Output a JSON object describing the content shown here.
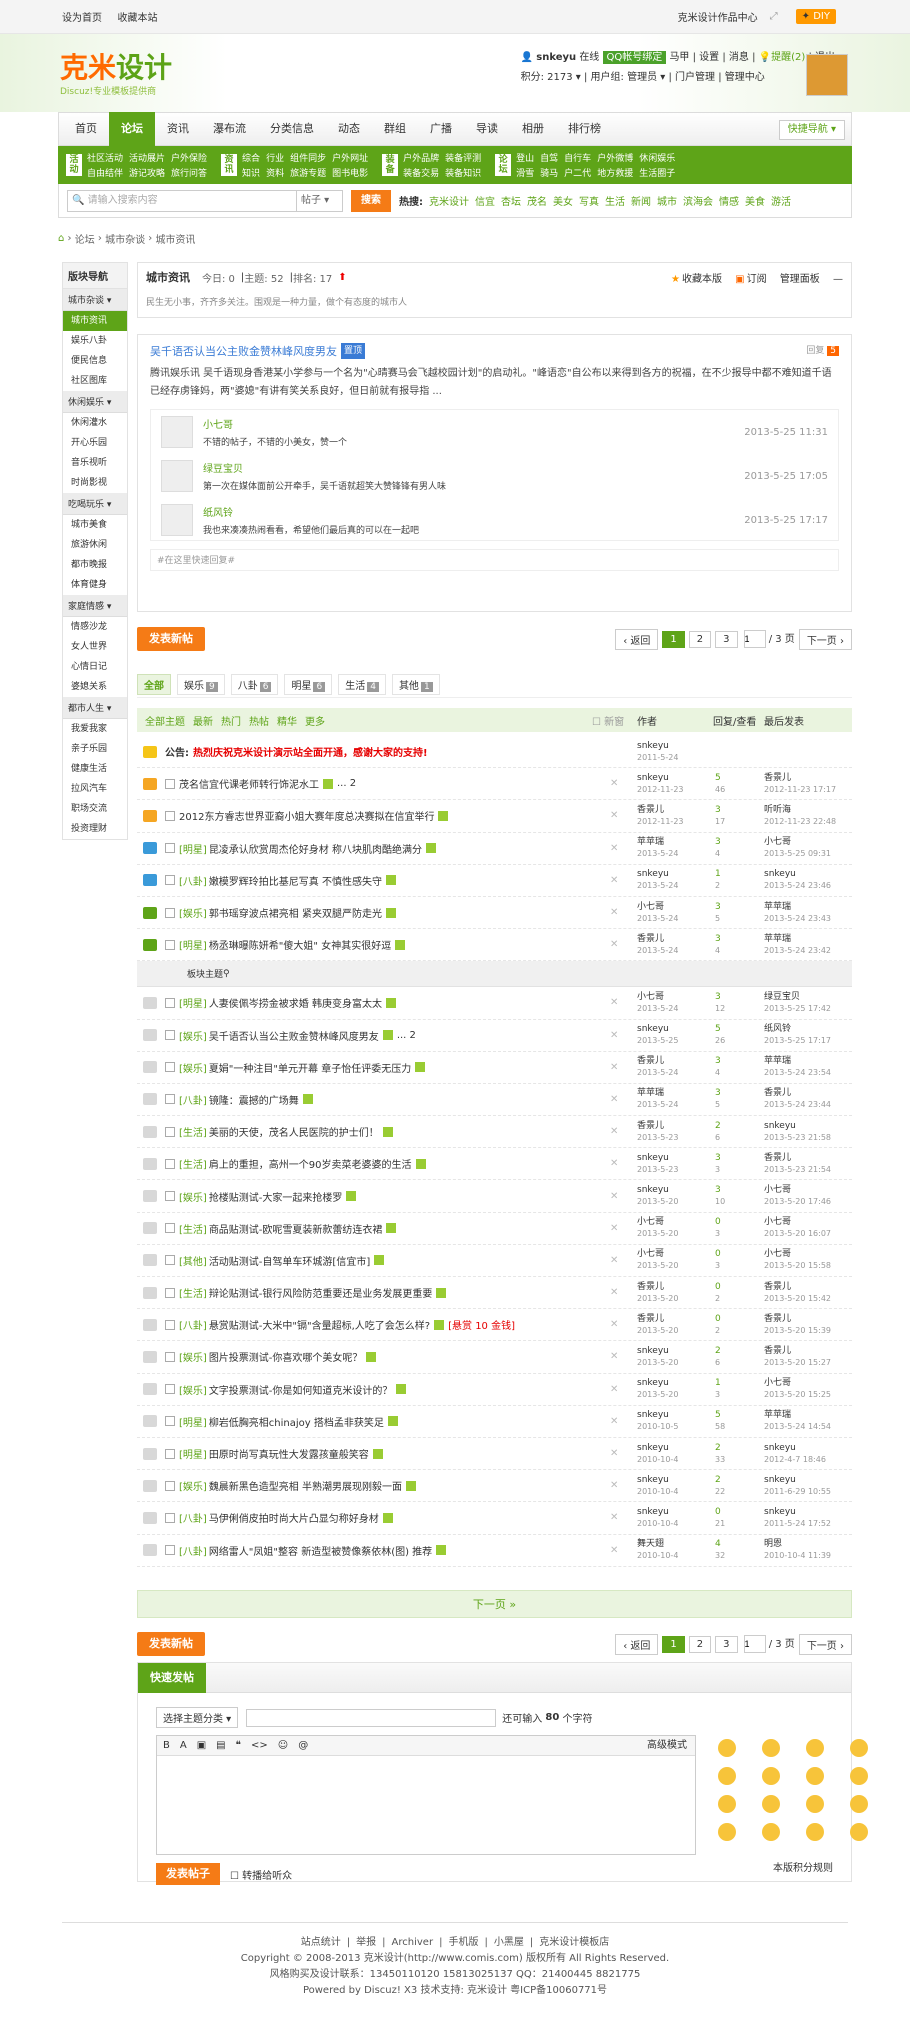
{
  "topbar": {
    "left": [
      "设为首页",
      "收藏本站"
    ],
    "right": "克米设计作品中心",
    "diy": "DIY"
  },
  "logo": {
    "text1": "克米",
    "text2": "设计",
    "sub": "Discuz!专业模板提供商"
  },
  "user": {
    "name": "snkeyu",
    "online": "在线",
    "qq": "QQ帐号绑定",
    "items": [
      "马甲",
      "设置",
      "消息",
      "提醒(2)",
      "退出"
    ],
    "points": "积分: 2173",
    "group": "用户组: 管理员",
    "links": [
      "门户管理",
      "管理中心"
    ]
  },
  "nav": {
    "items": [
      "首页",
      "论坛",
      "资讯",
      "瀑布流",
      "分类信息",
      "动态",
      "群组",
      "广播",
      "导读",
      "相册",
      "排行榜"
    ],
    "active": 1,
    "quick": "快捷导航"
  },
  "subnav": [
    {
      "tag": "活动",
      "items": [
        "社区活动",
        "活动展片",
        "户外保险",
        "自由结伴",
        "游记攻略",
        "旅行问答"
      ]
    },
    {
      "tag": "资讯",
      "items": [
        "综合",
        "行业",
        "组件同步",
        "户外网址",
        "知识",
        "资料",
        "旅游专题",
        "图书电影"
      ]
    },
    {
      "tag": "装备",
      "items": [
        "户外品牌",
        "装备评测",
        "装备交易",
        "装备知识"
      ]
    },
    {
      "tag": "论坛",
      "items": [
        "登山",
        "自驾",
        "自行车",
        "户外微博",
        "休闲娱乐",
        "滑雪",
        "骑马",
        "户二代",
        "地方救援",
        "生活圈子"
      ]
    }
  ],
  "search": {
    "placeholder": "请输入搜索内容",
    "type": "帖子",
    "button": "搜索",
    "hot_label": "热搜:",
    "hot": [
      "克米设计",
      "信宜",
      "杏坛",
      "茂名",
      "美女",
      "写真",
      "生活",
      "新闻",
      "城市",
      "滨海会",
      "情感",
      "美食",
      "游活"
    ]
  },
  "crumb": [
    "论坛",
    "城市杂谈",
    "城市资讯"
  ],
  "sidebar": {
    "title": "版块导航",
    "groups": [
      {
        "name": "城市杂谈",
        "items": [
          "城市资讯",
          "娱乐八卦",
          "便民信息",
          "社区图库"
        ]
      },
      {
        "name": "休闲娱乐",
        "items": [
          "休闲灌水",
          "开心乐园",
          "音乐视听",
          "时尚影视"
        ]
      },
      {
        "name": "吃喝玩乐",
        "items": [
          "城市美食",
          "旅游休闲",
          "都市晚报",
          "体育健身"
        ]
      },
      {
        "name": "家庭情感",
        "items": [
          "情感沙龙",
          "女人世界",
          "心情日记",
          "婆媳关系"
        ]
      },
      {
        "name": "都市人生",
        "items": [
          "我爱我家",
          "亲子乐园",
          "健康生活",
          "拉风汽车",
          "职场交流",
          "投资理财"
        ]
      }
    ]
  },
  "forum": {
    "name": "城市资讯",
    "today": "今日: 0",
    "topics": "主题: 52",
    "rank": "排名: 17",
    "fav": "收藏本版",
    "rss": "订阅",
    "admin": "管理面板",
    "desc": "民生无小事，齐齐多关注。围观是一种力量，做个有态度的城市人"
  },
  "topic": {
    "title": "吴千语否认当公主败金赞林峰风度男友",
    "badge": "置顶",
    "reply_label": "回复",
    "reply": "5",
    "body": "腾讯娱乐讯 吴千语现身香港某小学参与一个名为\"心晴赛马会飞越校园计划\"的启动礼。\"峰语恋\"自公布以来得到各方的祝福，在不少报导中都不难知道千语已经存虏锋妈，两\"婆媳\"有讲有笑关系良好，但日前就有报导指 ...",
    "comments": [
      {
        "name": "小七哥",
        "text": "不错的帖子，不错的小美女，赞一个",
        "date": "2013-5-25 11:31"
      },
      {
        "name": "绿豆宝贝",
        "text": "第一次在媒体面前公开牵手，吴千语就超笑大赞锋锋有男人味",
        "date": "2013-5-25 17:05"
      },
      {
        "name": "纸风铃",
        "text": "我也来凑凑热闹看看，希望他们最后真的可以在一起吧",
        "date": "2013-5-25 17:17"
      }
    ],
    "quick_reply": "#在这里快速回复#"
  },
  "post_btn": "发表新帖",
  "pager": {
    "prev": "返回",
    "pages": [
      "1",
      "2",
      "3"
    ],
    "current": "1",
    "total": "/ 3 页",
    "next": "下一页"
  },
  "filters": [
    {
      "label": "全部",
      "n": ""
    },
    {
      "label": "娱乐",
      "n": "9"
    },
    {
      "label": "八卦",
      "n": "6"
    },
    {
      "label": "明星",
      "n": "6"
    },
    {
      "label": "生活",
      "n": "4"
    },
    {
      "label": "其他",
      "n": "1"
    }
  ],
  "thead": {
    "items": [
      "全部主题",
      "最新",
      "热门",
      "热帖",
      "精华",
      "更多"
    ],
    "newwin": "新窗",
    "author": "作者",
    "replies": "回复/查看",
    "last": "最后发表"
  },
  "announce": {
    "label": "公告:",
    "text": "热烈庆祝克米设计演示站全面开通，感谢大家的支持!",
    "author": "snkeyu",
    "date": "2011-5-24"
  },
  "sticky": [
    {
      "cat": "",
      "title": "茂名信宜代课老师转行饰泥水工",
      "tail": "... 2",
      "au": "snkeyu",
      "ad": "2012-11-23",
      "r": "5",
      "v": "46",
      "lu": "香景儿",
      "ld": "2012-11-23 17:17",
      "ic": "#f5a623"
    },
    {
      "cat": "",
      "title": "2012东方睿志世界亚裔小姐大赛年度总决赛拟在信宜举行",
      "tail": "",
      "au": "香景儿",
      "ad": "2012-11-23",
      "r": "3",
      "v": "17",
      "lu": "听听海",
      "ld": "2012-11-23 22:48",
      "ic": "#f5a623"
    },
    {
      "cat": "[明星]",
      "title": "昆凌承认欣赏周杰伦好身材 称八块肌肉酷绝满分",
      "tail": "",
      "au": "苹苹瑞",
      "ad": "2013-5-24",
      "r": "3",
      "v": "4",
      "lu": "小七哥",
      "ld": "2013-5-25 09:31",
      "ic": "#3a9ad9"
    },
    {
      "cat": "[八卦]",
      "title": "嫩模罗辉玲拍比基尼写真 不慎性感失守",
      "tail": "",
      "au": "snkeyu",
      "ad": "2013-5-24",
      "r": "1",
      "v": "2",
      "lu": "snkeyu",
      "ld": "2013-5-24 23:46",
      "ic": "#3a9ad9"
    },
    {
      "cat": "[娱乐]",
      "title": "郭书瑶穿波点裙亮相 紧夹双腿严防走光",
      "tail": "",
      "au": "小七哥",
      "ad": "2013-5-24",
      "r": "3",
      "v": "5",
      "lu": "苹苹瑞",
      "ld": "2013-5-24 23:43",
      "ic": "#5ea418"
    },
    {
      "cat": "[明星]",
      "title": "杨丞琳曝陈妍希\"傻大姐\" 女神其实很好逗",
      "tail": "",
      "au": "香景儿",
      "ad": "2013-5-24",
      "r": "3",
      "v": "4",
      "lu": "苹苹瑞",
      "ld": "2013-5-24 23:42",
      "ic": "#5ea418"
    }
  ],
  "sep": "板块主题",
  "normal": [
    {
      "cat": "[明星]",
      "title": "人妻侯佩岑捞金被求婚 韩庚变身富太太",
      "tail": "",
      "au": "小七哥",
      "ad": "2013-5-24",
      "r": "3",
      "v": "12",
      "lu": "绿豆宝贝",
      "ld": "2013-5-25 17:42"
    },
    {
      "cat": "[娱乐]",
      "title": "吴千语否认当公主败金赞林峰风度男友",
      "tail": "... 2",
      "au": "snkeyu",
      "ad": "2013-5-25",
      "r": "5",
      "v": "26",
      "lu": "纸风铃",
      "ld": "2013-5-25 17:17"
    },
    {
      "cat": "[娱乐]",
      "title": "夏娟\"一种注目\"单元开幕 章子怡任评委无压力",
      "tail": "",
      "au": "香景儿",
      "ad": "2013-5-24",
      "r": "3",
      "v": "4",
      "lu": "苹苹瑞",
      "ld": "2013-5-24 23:54"
    },
    {
      "cat": "[八卦]",
      "title": "镜隆：震撼的广场舞",
      "tail": "",
      "au": "苹苹瑞",
      "ad": "2013-5-24",
      "r": "3",
      "v": "5",
      "lu": "香景儿",
      "ld": "2013-5-24 23:44"
    },
    {
      "cat": "[生活]",
      "title": "美丽的天使，茂名人民医院的护士们！",
      "tail": "",
      "au": "香景儿",
      "ad": "2013-5-23",
      "r": "2",
      "v": "6",
      "lu": "snkeyu",
      "ld": "2013-5-23 21:58"
    },
    {
      "cat": "[生活]",
      "title": "肩上的重担，高州一个90岁卖菜老婆婆的生活",
      "tail": "",
      "au": "snkeyu",
      "ad": "2013-5-23",
      "r": "3",
      "v": "3",
      "lu": "香景儿",
      "ld": "2013-5-23 21:54"
    },
    {
      "cat": "[娱乐]",
      "title": "抢楼贴测试-大家一起来抢楼罗",
      "tail": "",
      "au": "snkeyu",
      "ad": "2013-5-20",
      "r": "3",
      "v": "10",
      "lu": "小七哥",
      "ld": "2013-5-20 17:46"
    },
    {
      "cat": "[生活]",
      "title": "商品贴测试-欧呢雪夏装新款蕾纺连衣裙",
      "tail": "",
      "au": "小七哥",
      "ad": "2013-5-20",
      "r": "0",
      "v": "3",
      "lu": "小七哥",
      "ld": "2013-5-20 16:07"
    },
    {
      "cat": "[其他]",
      "title": "活动贴测试-自驾单车环城游[信宜市]",
      "tail": "",
      "au": "小七哥",
      "ad": "2013-5-20",
      "r": "0",
      "v": "3",
      "lu": "小七哥",
      "ld": "2013-5-20 15:58"
    },
    {
      "cat": "[生活]",
      "title": "辩论贴测试-银行风险防范重要还是业务发展更重要",
      "tail": "",
      "au": "香景儿",
      "ad": "2013-5-20",
      "r": "0",
      "v": "2",
      "lu": "香景儿",
      "ld": "2013-5-20 15:42"
    },
    {
      "cat": "[八卦]",
      "title": "悬赏贴测试-大米中\"镉\"含量超标,人吃了会怎么样?",
      "tail": "[悬赏 10 金钱]",
      "au": "香景儿",
      "ad": "2013-5-20",
      "r": "0",
      "v": "2",
      "lu": "香景儿",
      "ld": "2013-5-20 15:39"
    },
    {
      "cat": "[娱乐]",
      "title": "图片投票测试-你喜欢哪个美女呢？",
      "tail": "",
      "au": "snkeyu",
      "ad": "2013-5-20",
      "r": "2",
      "v": "6",
      "lu": "香景儿",
      "ld": "2013-5-20 15:27"
    },
    {
      "cat": "[娱乐]",
      "title": "文字投票测试-你是如何知道克米设计的？",
      "tail": "",
      "au": "snkeyu",
      "ad": "2013-5-20",
      "r": "1",
      "v": "3",
      "lu": "小七哥",
      "ld": "2013-5-20 15:25"
    },
    {
      "cat": "[明星]",
      "title": "柳岩低胸亮相chinajoy 搭档孟非获笑足",
      "tail": "",
      "au": "snkeyu",
      "ad": "2010-10-5",
      "r": "5",
      "v": "58",
      "lu": "苹苹瑞",
      "ld": "2013-5-24 14:54"
    },
    {
      "cat": "[明星]",
      "title": "田原时尚写真玩性大发露孩童般笑容",
      "tail": "",
      "au": "snkeyu",
      "ad": "2010-10-4",
      "r": "2",
      "v": "33",
      "lu": "snkeyu",
      "ld": "2012-4-7 18:46"
    },
    {
      "cat": "[娱乐]",
      "title": "魏晨新黑色造型亮相 半熟潮男展现刚毅一面",
      "tail": "",
      "au": "snkeyu",
      "ad": "2010-10-4",
      "r": "2",
      "v": "22",
      "lu": "snkeyu",
      "ld": "2011-6-29 10:55"
    },
    {
      "cat": "[八卦]",
      "title": "马伊俐俏皮拍时尚大片凸显匀称好身材",
      "tail": "",
      "au": "snkeyu",
      "ad": "2010-10-4",
      "r": "0",
      "v": "21",
      "lu": "snkeyu",
      "ld": "2011-5-24 17:52"
    },
    {
      "cat": "[八卦]",
      "title": "网络雷人\"凤姐\"整容 新造型被赞像蔡依林(图) 推荐",
      "tail": "",
      "au": "舞天翅",
      "ad": "2010-10-4",
      "r": "4",
      "v": "32",
      "lu": "明恩",
      "ld": "2010-10-4 11:39"
    }
  ],
  "nextpage": "下一页 »",
  "quickpost": {
    "title": "快速发帖",
    "select": "选择主题分类",
    "remain_pre": "还可输入",
    "remain_num": "80",
    "remain_post": "个字符",
    "tools": [
      "B",
      "A",
      "▣",
      "▤",
      "❝",
      "<>",
      "☺",
      "@"
    ],
    "adv": "高级模式",
    "submit": "发表帖子",
    "chk": "转播给听众",
    "rule": "本版积分规则"
  },
  "footer": {
    "links": [
      "站点统计",
      "举报",
      "Archiver",
      "手机版",
      "小黑屋",
      "克米设计模板店"
    ],
    "copy": "Copyright © 2008-2013 克米设计(http://www.comis.com) 版权所有 All Rights Reserved.",
    "contact": "风格购买及设计联系：13450110120 15813025137 QQ：21400445 8821775",
    "powered": "Powered by Discuz! X3  技术支持: 克米设计 粤ICP备10060771号"
  }
}
